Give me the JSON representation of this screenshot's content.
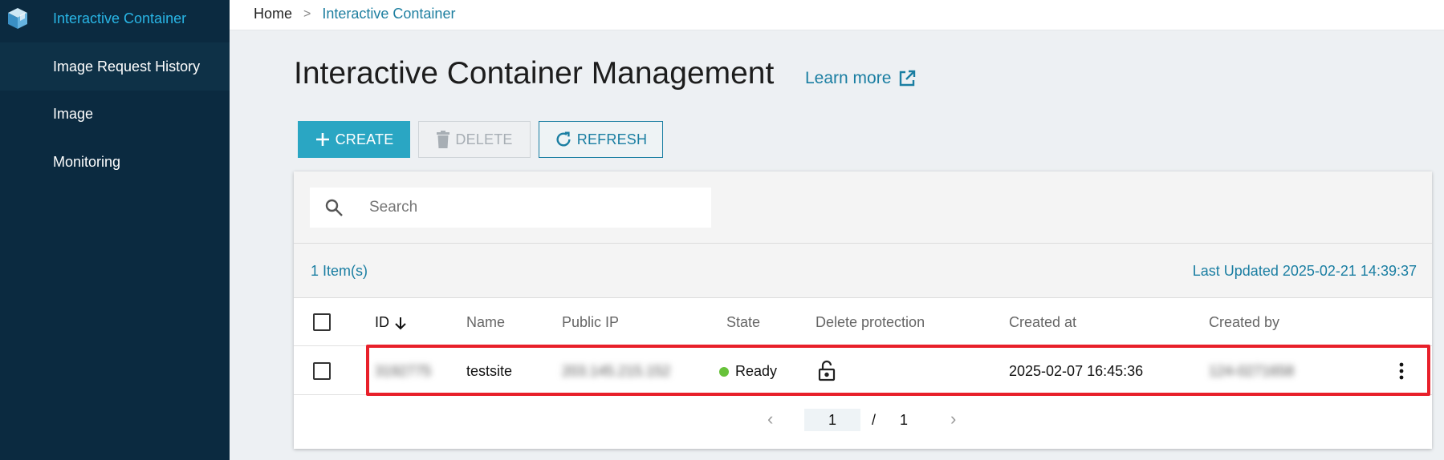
{
  "sidebar": {
    "items": [
      {
        "label": "Interactive Container"
      },
      {
        "label": "Image Request History"
      },
      {
        "label": "Image"
      },
      {
        "label": "Monitoring"
      }
    ],
    "active_color": "#29b6e6",
    "background": "#0b2a40"
  },
  "breadcrumb": {
    "home": "Home",
    "separator": ">",
    "current": "Interactive Container"
  },
  "page": {
    "title": "Interactive Container Management",
    "learn_more": "Learn more"
  },
  "toolbar": {
    "create_label": "CREATE",
    "delete_label": "DELETE",
    "refresh_label": "REFRESH"
  },
  "search": {
    "placeholder": "Search",
    "value": ""
  },
  "list_info": {
    "items_count": "1 Item(s)",
    "last_updated": "Last Updated 2025-02-21 14:39:37"
  },
  "table": {
    "columns": [
      "ID",
      "Name",
      "Public IP",
      "State",
      "Delete protection",
      "Created at",
      "Created by"
    ],
    "rows": [
      {
        "id": "3192775",
        "name": "testsite",
        "public_ip": "203.145.215.152",
        "state": "Ready",
        "created_at": "2025-02-07 16:45:36",
        "created_by": "124-0271658"
      }
    ]
  },
  "pagination": {
    "current": "1",
    "separator": "/",
    "total": "1"
  },
  "colors": {
    "accent": "#2aa6c3",
    "link": "#1a7ea2",
    "ready": "#67c23a",
    "highlight": "#e8202a"
  }
}
